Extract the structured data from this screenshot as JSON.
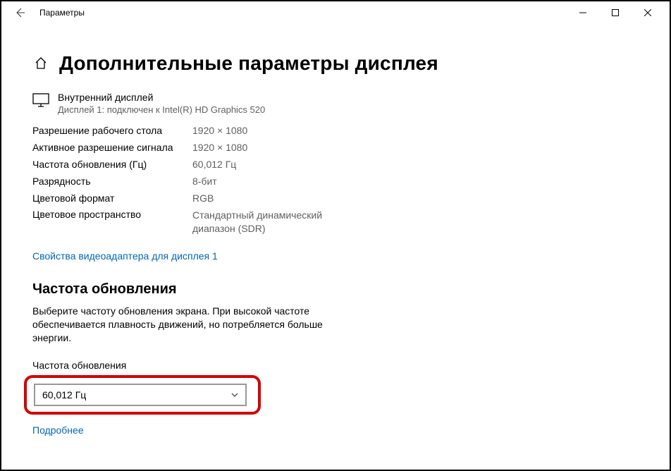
{
  "window": {
    "title": "Параметры"
  },
  "page": {
    "title": "Дополнительные параметры дисплея"
  },
  "display": {
    "name": "Внутренний дисплей",
    "sub": "Дисплей 1: подключен к Intel(R) HD Graphics 520"
  },
  "info": {
    "rows": [
      {
        "label": "Разрешение рабочего стола",
        "value": "1920 × 1080"
      },
      {
        "label": "Активное разрешение сигнала",
        "value": "1920 × 1080"
      },
      {
        "label": "Частота обновления (Гц)",
        "value": "60,012 Гц"
      },
      {
        "label": "Разрядность",
        "value": "8-бит"
      },
      {
        "label": "Цветовой формат",
        "value": "RGB"
      },
      {
        "label": "Цветовое пространство",
        "value": "Стандартный динамический диапазон (SDR)"
      }
    ]
  },
  "adapter_link": "Свойства видеоадаптера для дисплея 1",
  "refresh": {
    "section_title": "Частота обновления",
    "section_desc": "Выберите частоту обновления экрана. При высокой частоте обеспечивается плавность движений, но потребляется больше энергии.",
    "field_label": "Частота обновления",
    "value": "60,012 Гц",
    "more_link": "Подробнее"
  }
}
